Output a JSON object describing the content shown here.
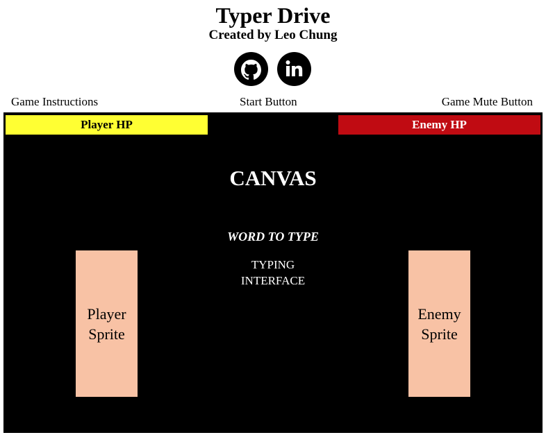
{
  "header": {
    "title": "Typer Drive",
    "subtitle": "Created by Leo Chung"
  },
  "social": [
    {
      "icon": "github-icon"
    },
    {
      "icon": "linkedin-icon"
    }
  ],
  "controls": {
    "instructions_label": "Game Instructions",
    "start_label": "Start Button",
    "mute_label": "Game Mute Button"
  },
  "canvas": {
    "label": "CANVAS",
    "player_hp_label": "Player HP",
    "enemy_hp_label": "Enemy HP",
    "word_to_type": "WORD TO TYPE",
    "typing_interface_line1": "TYPING",
    "typing_interface_line2": "INTERFACE",
    "player_sprite_line1": "Player",
    "player_sprite_line2": "Sprite",
    "enemy_sprite_line1": "Enemy",
    "enemy_sprite_line2": "Sprite"
  },
  "colors": {
    "player_hp": "#ffff33",
    "enemy_hp": "#c00b12",
    "canvas_bg": "#000000",
    "sprite_fill": "#f8c2a5"
  }
}
